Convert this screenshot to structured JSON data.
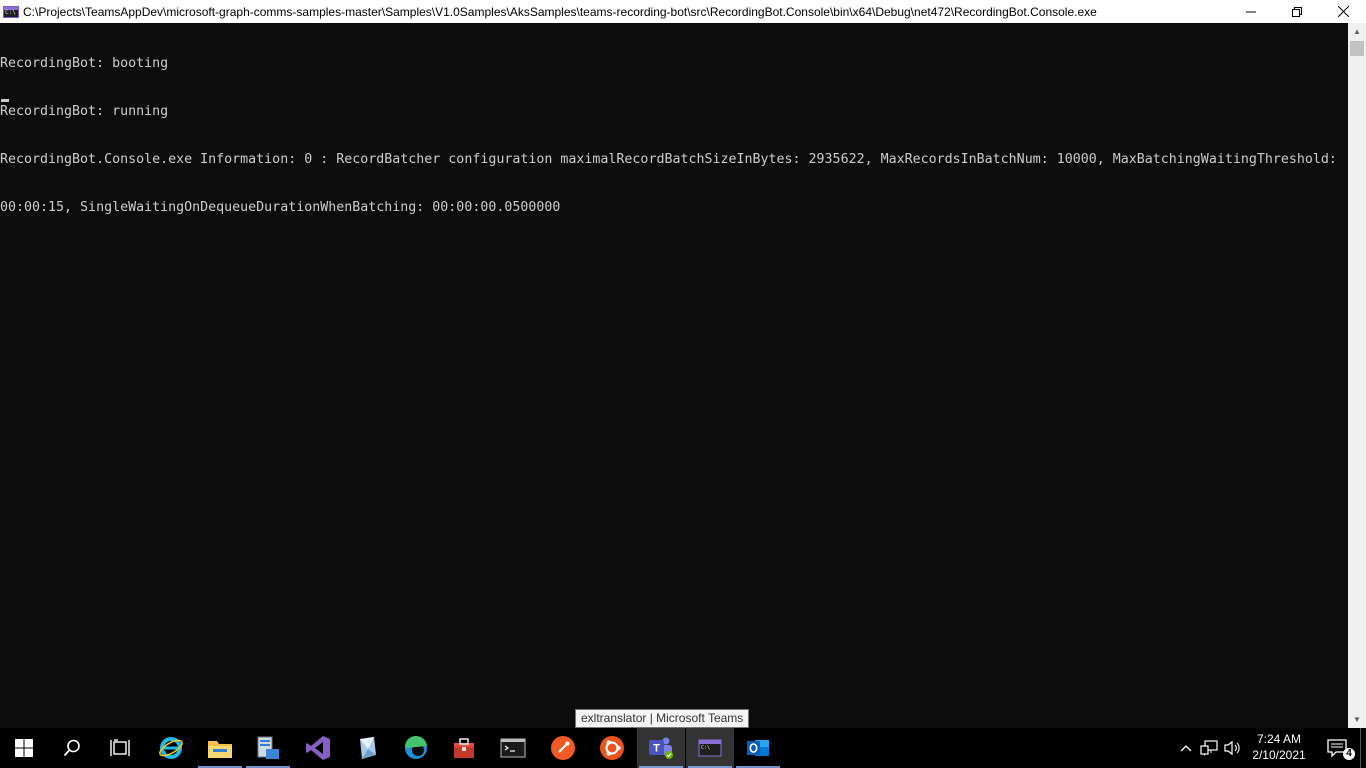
{
  "window": {
    "title": "C:\\Projects\\TeamsAppDev\\microsoft-graph-comms-samples-master\\Samples\\V1.0Samples\\AksSamples\\teams-recording-bot\\src\\RecordingBot.Console\\bin\\x64\\Debug\\net472\\RecordingBot.Console.exe",
    "icon": "console-app-icon",
    "controls": {
      "minimize": "minimize-icon",
      "restore": "restore-icon",
      "close": "close-icon"
    }
  },
  "console": {
    "lines": [
      "RecordingBot: booting",
      "RecordingBot: running",
      "RecordingBot.Console.exe Information: 0 : RecordBatcher configuration maximalRecordBatchSizeInBytes: 2935622, MaxRecordsInBatchNum: 10000, MaxBatchingWaitingThreshold:",
      "00:00:15, SingleWaitingOnDequeueDurationWhenBatching: 00:00:00.0500000"
    ],
    "text_color": "#cccccc",
    "background": "#0c0c0c"
  },
  "tooltip": {
    "text": "exltranslator | Microsoft Teams"
  },
  "taskbar": {
    "buttons": [
      {
        "name": "start-button",
        "icon": "windows-logo-icon"
      },
      {
        "name": "search-button",
        "icon": "search-icon"
      },
      {
        "name": "task-view-button",
        "icon": "task-view-icon"
      },
      {
        "name": "internet-explorer-button",
        "icon": "internet-explorer-icon"
      },
      {
        "name": "file-explorer-button",
        "icon": "folder-icon"
      },
      {
        "name": "server-manager-button",
        "icon": "server-manager-icon"
      },
      {
        "name": "visual-studio-button",
        "icon": "visual-studio-icon"
      },
      {
        "name": "azure-data-studio-button",
        "icon": "azure-data-studio-icon"
      },
      {
        "name": "edge-button",
        "icon": "edge-icon"
      },
      {
        "name": "toolbox-button",
        "icon": "toolbox-icon"
      },
      {
        "name": "terminal-button",
        "icon": "terminal-icon"
      },
      {
        "name": "postman-button",
        "icon": "postman-icon"
      },
      {
        "name": "ubuntu-button",
        "icon": "ubuntu-icon"
      },
      {
        "name": "teams-button",
        "icon": "teams-icon"
      },
      {
        "name": "console-window-button",
        "icon": "console-icon"
      },
      {
        "name": "outlook-button",
        "icon": "outlook-icon"
      }
    ],
    "tray": {
      "time": "7:24 AM",
      "date": "2/10/2021",
      "notification_count": "4"
    }
  }
}
